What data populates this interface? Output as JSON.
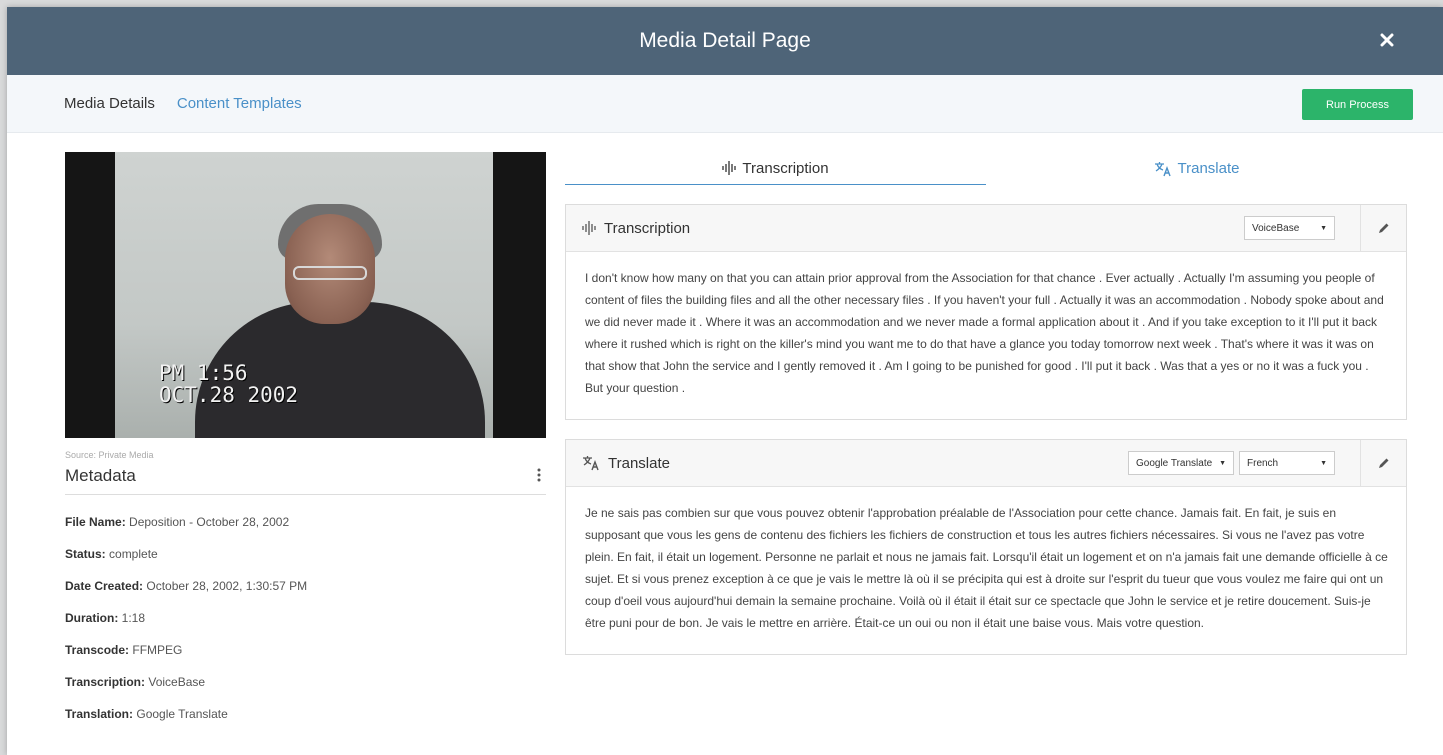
{
  "header": {
    "title": "Media Detail Page"
  },
  "subnav": {
    "media_details": "Media Details",
    "content_templates": "Content Templates",
    "run_process": "Run Process"
  },
  "video": {
    "stamp_time": "PM 1:56",
    "stamp_date": "OCT.28 2002",
    "source": "Source: Private Media"
  },
  "metadata": {
    "title": "Metadata",
    "rows": [
      {
        "label": "File Name:",
        "value": "Deposition - October 28, 2002"
      },
      {
        "label": "Status:",
        "value": "complete"
      },
      {
        "label": "Date Created:",
        "value": "October 28, 2002, 1:30:57 PM"
      },
      {
        "label": "Duration:",
        "value": "1:18"
      },
      {
        "label": "Transcode:",
        "value": "FFMPEG"
      },
      {
        "label": "Transcription:",
        "value": "VoiceBase"
      },
      {
        "label": "Translation:",
        "value": "Google Translate"
      }
    ]
  },
  "tabs": [
    {
      "label": "Transcription",
      "icon": "waveform-icon",
      "active": true
    },
    {
      "label": "Translate",
      "icon": "translate-icon",
      "active": false
    }
  ],
  "transcription_panel": {
    "title": "Transcription",
    "engine": "VoiceBase",
    "text": "I don't know how many on that you can attain prior approval from the Association for that chance . Ever actually . Actually I'm assuming you people of content of files the building files and all the other necessary files . If you haven't your full . Actually it was an accommodation . Nobody spoke about and we did never made it . Where it was an accommodation and we never made a formal application about it . And if you take exception to it I'll put it back where it rushed which is right on the killer's mind you want me to do that have a glance you today tomorrow next week . That's where it was it was on that show that John the service and I gently removed it . Am I going to be punished for good . I'll put it back . Was that a yes or no it was a fuck you . But your question ."
  },
  "translate_panel": {
    "title": "Translate",
    "engine": "Google Translate",
    "language": "French",
    "text": "Je ne sais pas combien sur que vous pouvez obtenir l'approbation préalable de l'Association pour cette chance. Jamais fait. En fait, je suis en supposant que vous les gens de contenu des fichiers les fichiers de construction et tous les autres fichiers nécessaires. Si vous ne l'avez pas votre plein. En fait, il était un logement. Personne ne parlait et nous ne jamais fait. Lorsqu'il était un logement et on n'a jamais fait une demande officielle à ce sujet. Et si vous prenez exception à ce que je vais le mettre là où il se précipita qui est à droite sur l'esprit du tueur que vous voulez me faire qui ont un coup d'oeil vous aujourd'hui demain la semaine prochaine. Voilà où il était il était sur ce spectacle que John le service et je retire doucement. Suis-je être puni pour de bon. Je vais le mettre en arrière. Était-ce un oui ou non il était une baise vous. Mais votre question."
  },
  "colors": {
    "header_bg": "#4e6478",
    "accent_link": "#4a90c8",
    "run_button": "#2cb46a"
  }
}
